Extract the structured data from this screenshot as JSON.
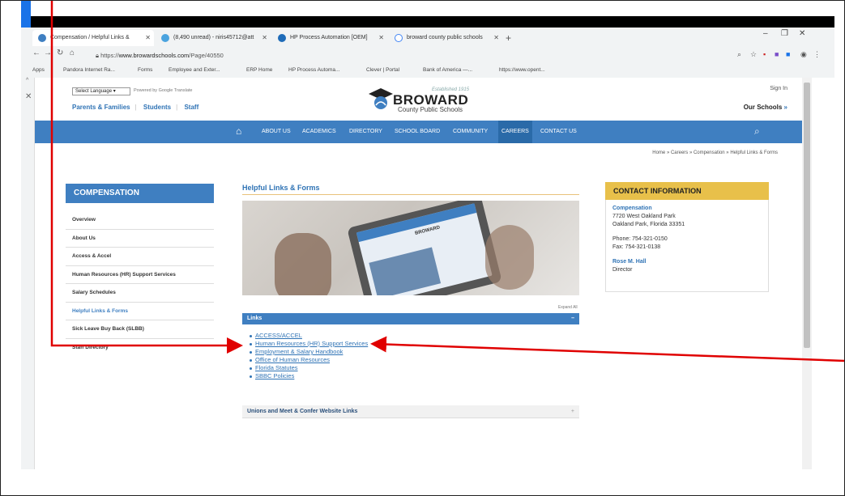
{
  "browser": {
    "tabs": [
      {
        "label": "Compensation / Helpful Links &",
        "icon": "bcps-favicon"
      },
      {
        "label": "(8,490 unread) - niris45712@att",
        "icon": "mail-icon"
      },
      {
        "label": "HP Process Automation [OEM]",
        "icon": "hp-icon"
      },
      {
        "label": "broward county public schools",
        "icon": "google-icon"
      }
    ],
    "url_prefix": "https://",
    "url_host": "www.browardschools.com",
    "url_path": "/Page/40550",
    "bookmarks": [
      "Apps",
      "Pandora Internet Ra...",
      "Forms",
      "Employee and Exter...",
      "ERP Home",
      "HP Process Automa...",
      "Clever | Portal",
      "Bank of America —...",
      "https://www.opent..."
    ]
  },
  "site": {
    "language_select": "Select Language",
    "powered_by": "Powered by Google Translate",
    "toplinks": [
      "Parents & Families",
      "Students",
      "Staff"
    ],
    "logo_established": "Established 1915",
    "logo_name": "BROWARD",
    "logo_sub": "County Public Schools",
    "sign_in": "Sign In",
    "our_schools": "Our Schools",
    "nav": [
      "ABOUT US",
      "ACADEMICS",
      "DIRECTORY",
      "SCHOOL BOARD",
      "COMMUNITY",
      "CAREERS",
      "CONTACT US"
    ],
    "nav_active": "CAREERS",
    "breadcrumb": "Home » Careers » Compensation » Helpful Links & Forms"
  },
  "sidebar": {
    "title": "COMPENSATION",
    "items": [
      "Overview",
      "About Us",
      "Access & Accel",
      "Human Resources (HR) Support Services",
      "Salary Schedules",
      "Helpful Links & Forms",
      "Sick Leave Buy Back (SLBB)",
      "Staff Directory"
    ],
    "current": "Helpful Links & Forms"
  },
  "main": {
    "title": "Helpful Links & Forms",
    "expand_all": "Expand All",
    "links_header": "Links",
    "links": [
      "ACCESS/ACCEL",
      "Human Resources (HR) Support Services",
      "Employment & Salary Handbook",
      "Office of Human Resources",
      "Florida Statutes",
      "SBBC Policies"
    ],
    "unions_header": "Unions and Meet & Confer Website Links"
  },
  "contact": {
    "title": "CONTACT INFORMATION",
    "dept": "Compensation",
    "address1": "7720 West Oakland Park",
    "address2": "Oakland Park, Florida 33351",
    "phone": "Phone: 754-321-0150",
    "fax": "Fax: 754-321-0138",
    "person": "Rose M. Hall",
    "role": "Director"
  },
  "colors": {
    "nav_blue": "#3f7fc1",
    "contact_gold": "#e8c04a",
    "annotation_red": "#e00000"
  }
}
